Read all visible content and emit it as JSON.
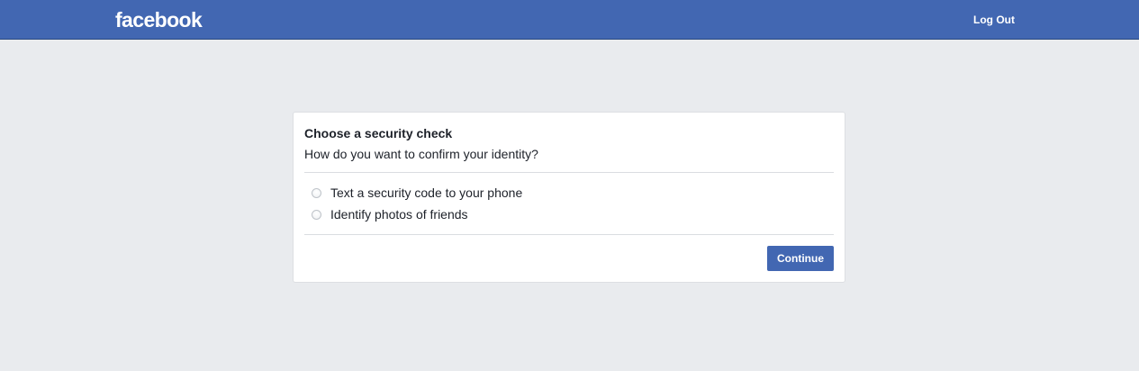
{
  "header": {
    "logo_text": "facebook",
    "logout_label": "Log Out"
  },
  "card": {
    "title": "Choose a security check",
    "subtitle": "How do you want to confirm your identity?",
    "options": [
      {
        "label": "Text a security code to your phone",
        "selected": false
      },
      {
        "label": "Identify photos of friends",
        "selected": false
      }
    ],
    "continue_label": "Continue"
  },
  "colors": {
    "header_bg": "#4267b2",
    "page_bg": "#e9ebee",
    "button_bg": "#4267b2",
    "text": "#1d2129"
  }
}
